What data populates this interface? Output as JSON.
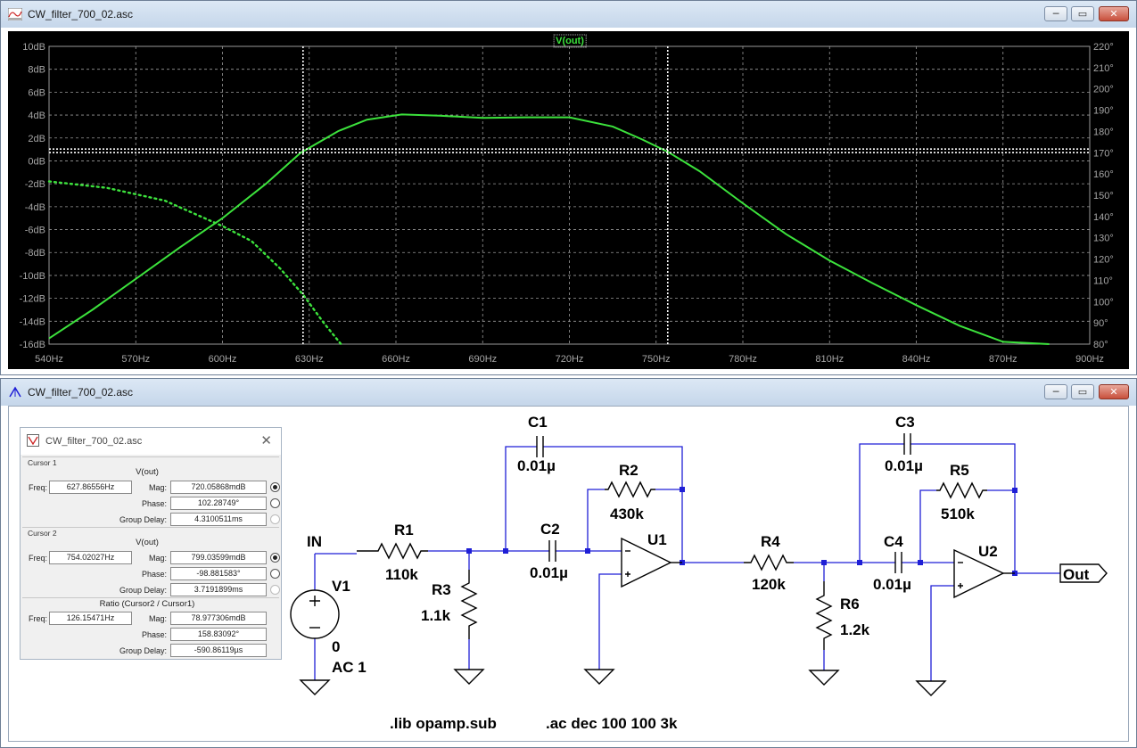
{
  "waveform_window": {
    "title": "CW_filter_700_02.asc",
    "trace_label": "V(out)",
    "colors": {
      "trace": "#3ce23c",
      "background": "#000000",
      "grid": "#9a9a9a",
      "tick_text": "#a6a6a6"
    },
    "buttons": {
      "minimize": "─",
      "maximize": "▭",
      "close": "✕"
    }
  },
  "chart_data": {
    "type": "line",
    "title": "V(out)",
    "xlabel": "",
    "ylabel": "",
    "x_ticks": [
      "540Hz",
      "570Hz",
      "600Hz",
      "630Hz",
      "660Hz",
      "690Hz",
      "720Hz",
      "750Hz",
      "780Hz",
      "810Hz",
      "840Hz",
      "870Hz",
      "900Hz"
    ],
    "y_left_ticks": [
      "10dB",
      "8dB",
      "6dB",
      "4dB",
      "2dB",
      "0dB",
      "-2dB",
      "-4dB",
      "-6dB",
      "-8dB",
      "-10dB",
      "-12dB",
      "-14dB",
      "-16dB"
    ],
    "y_right_ticks": [
      "220°",
      "210°",
      "200°",
      "190°",
      "180°",
      "170°",
      "160°",
      "150°",
      "140°",
      "130°",
      "120°",
      "110°",
      "100°",
      "90°",
      "80°"
    ],
    "xlim": [
      540,
      900
    ],
    "ylim_left": [
      -16,
      10
    ],
    "ylim_right": [
      80,
      220
    ],
    "grid": true,
    "series": [
      {
        "name": "V(out)",
        "style": "solid",
        "axis": "left",
        "x": [
          540,
          555,
          570,
          585,
          600,
          615,
          627,
          640,
          650,
          662,
          675,
          690,
          705,
          720,
          735,
          745,
          754,
          765,
          780,
          795,
          810,
          825,
          840,
          855,
          870,
          886
        ],
        "y": [
          -15.5,
          -13.0,
          -10.3,
          -7.6,
          -5.0,
          -2.0,
          0.7,
          2.6,
          3.6,
          4.05,
          3.95,
          3.75,
          3.8,
          3.8,
          3.0,
          1.9,
          0.8,
          -0.9,
          -3.7,
          -6.4,
          -8.7,
          -10.7,
          -12.6,
          -14.4,
          -15.8,
          -16.0
        ]
      },
      {
        "name": "",
        "style": "dotted",
        "axis": "right",
        "x": [
          540,
          560,
          580,
          600,
          610,
          620,
          628,
          635,
          641
        ],
        "y": [
          156.5,
          153.5,
          147.5,
          135.5,
          128.5,
          115.5,
          103,
          90,
          80
        ]
      }
    ],
    "cursors": [
      {
        "name": "Cursor 1",
        "freq": 627.86556,
        "mag_mdB": 720.05868
      },
      {
        "name": "Cursor 2",
        "freq": 754.02027,
        "mag_mdB": 799.03599
      }
    ]
  },
  "schematic_window": {
    "title": "CW_filter_700_02.asc",
    "colors": {
      "wire": "#1f1fd6",
      "node": "#1f1fd6",
      "component": "#000000"
    },
    "buttons": {
      "minimize": "─",
      "maximize": "▭",
      "close": "✕"
    },
    "labels": {
      "in": "IN",
      "out": "Out",
      "c1": "C1",
      "c1_val": "0.01µ",
      "c2": "C2",
      "c2_val": "0.01µ",
      "c3": "C3",
      "c3_val": "0.01µ",
      "c4": "C4",
      "c4_val": "0.01µ",
      "r1": "R1",
      "r1_val": "110k",
      "r2": "R2",
      "r2_val": "430k",
      "r3": "R3",
      "r3_val": "1.1k",
      "r4": "R4",
      "r4_val": "120k",
      "r5": "R5",
      "r5_val": "510k",
      "r6": "R6",
      "r6_val": "1.2k",
      "u1": "U1",
      "u2": "U2",
      "v1": "V1",
      "v1_dc": "0",
      "v1_ac": "AC 1",
      "directive_lib": ".lib opamp.sub",
      "directive_ac": ".ac dec 100 100 3k"
    }
  },
  "cursor_window": {
    "title": "CW_filter_700_02.asc",
    "close": "✕",
    "cursor1": {
      "group": "Cursor 1",
      "trace": "V(out)",
      "freq_label": "Freq:",
      "freq": "627.86556Hz",
      "mag_label": "Mag:",
      "mag": "720.05868mdB",
      "phase_label": "Phase:",
      "phase": "102.28749°",
      "gd_label": "Group Delay:",
      "gd": "4.3100511ms"
    },
    "cursor2": {
      "group": "Cursor 2",
      "trace": "V(out)",
      "freq_label": "Freq:",
      "freq": "754.02027Hz",
      "mag_label": "Mag:",
      "mag": "799.03599mdB",
      "phase_label": "Phase:",
      "phase": "-98.881583°",
      "gd_label": "Group Delay:",
      "gd": "3.7191899ms"
    },
    "ratio": {
      "group": "Ratio (Cursor2 / Cursor1)",
      "freq_label": "Freq:",
      "freq": "126.15471Hz",
      "mag_label": "Mag:",
      "mag": "78.977306mdB",
      "phase_label": "Phase:",
      "phase": "158.83092°",
      "gd_label": "Group Delay:",
      "gd": "-590.86119µs"
    }
  }
}
